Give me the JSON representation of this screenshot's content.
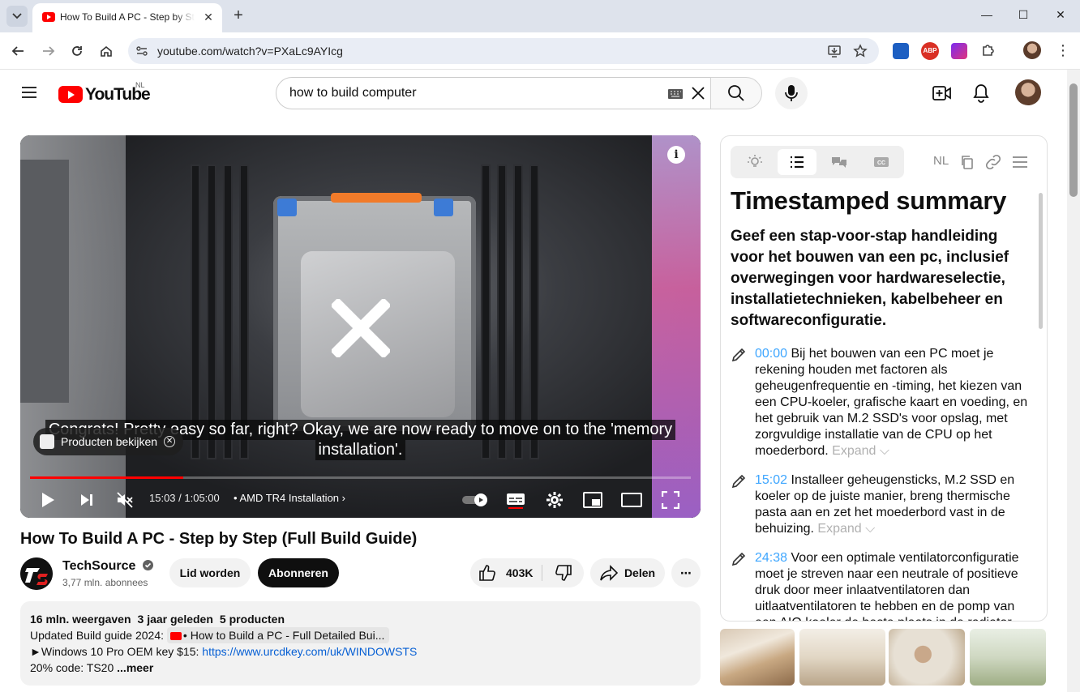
{
  "browser": {
    "tab_title": "How To Build A PC - Step by Step (Full Build Guide) - YouTube",
    "url": "youtube.com/watch?v=PXaLc9AYIcg",
    "close_glyph": "✕",
    "new_tab_glyph": "+",
    "window_buttons": {
      "minimize": "—",
      "maximize": "☐",
      "close": "✕"
    },
    "extension_abp": "ABP"
  },
  "masthead": {
    "logo_text": "YouTube",
    "country_code": "NL",
    "search_query": "how to build computer"
  },
  "player": {
    "caption_line1": "Congrats! Pretty easy so far, right? Okay, we are now ready to move on to the 'memory",
    "caption_line2": "installation'.",
    "products_chip": "Producten bekijken",
    "time": "15:03 / 1:05:00",
    "chapter": "• AMD TR4 Installation",
    "chapter_arrow": "›",
    "info_glyph": "i",
    "progress_played": 0.2315,
    "progress_buffered": 0.225
  },
  "video": {
    "title": "How To Build A PC - Step by Step (Full Build Guide)",
    "channel_name": "TechSource",
    "channel_subs": "3,77 mln. abonnees",
    "join_label": "Lid worden",
    "subscribe_label": "Abonneren",
    "likes": "403K",
    "share_label": "Delen",
    "more_glyph": "⋯"
  },
  "description": {
    "views": "16 mln. weergaven",
    "age": "3 jaar geleden",
    "products": "5 producten",
    "line2_prefix": "Updated Build guide 2024:",
    "line2_chip": "• How to Build a PC - Full Detailed Bui...",
    "line3_prefix": "►Windows 10 Pro OEM key $15:",
    "line3_link": "https://www.urcdkey.com/uk/WINDOWSTS",
    "line4_prefix": "20% code: TS20",
    "more_label": "...meer"
  },
  "summary": {
    "lang": "NL",
    "heading": "Timestamped summary",
    "prompt": "Geef een stap-voor-stap handleiding voor het bouwen van een pc, inclusief overwegingen voor hardwareselectie, installatietechnieken, kabelbeheer en softwareconfiguratie.",
    "expand_label": "Expand",
    "entries": [
      {
        "ts": "00:00",
        "text": "Bij het bouwen van een PC moet je rekening houden met factoren als geheugenfrequentie en -timing, het kiezen van een CPU-koeler, grafische kaart en voeding, en het gebruik van M.2 SSD's voor opslag, met zorgvuldige installatie van de CPU op het moederbord."
      },
      {
        "ts": "15:02",
        "text": "Installeer geheugensticks, M.2 SSD en koeler op de juiste manier, breng thermische pasta aan en zet het moederbord vast in de behuizing."
      },
      {
        "ts": "24:38",
        "text": "Voor een optimale ventilatorconfiguratie moet je streven naar een neutrale of positieve druk door meer inlaatventilatoren dan uitlaatventilatoren te hebben en de pomp van een AIO koeler de beste plaats in de radiator"
      }
    ]
  },
  "colors": {
    "youtube_red": "#ff0000",
    "timestamp_blue": "#3ea6ff",
    "link_blue": "#065fd4",
    "chrome_tabbar": "#dee3ec"
  }
}
